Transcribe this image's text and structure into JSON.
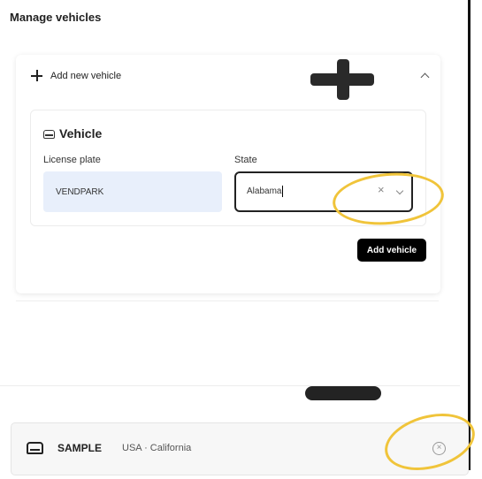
{
  "page": {
    "title": "Manage vehicles"
  },
  "add_section": {
    "header_label": "Add new vehicle",
    "form": {
      "title": "Vehicle",
      "plate_label": "License plate",
      "plate_value": "VENDPARK",
      "state_label": "State",
      "state_value": "Alabama"
    },
    "submit_label": "Add vehicle"
  },
  "vehicles": [
    {
      "name": "SAMPLE",
      "location": "USA · California"
    }
  ],
  "colors": {
    "primary_button": "#000000",
    "plate_input_bg": "#e8effb",
    "annotation_highlight": "#f0c43a"
  },
  "icons": {
    "plus": "plus-icon",
    "chevron": "chevron-up-icon",
    "car": "car-icon",
    "clear": "clear-icon",
    "remove": "remove-circle-icon"
  }
}
